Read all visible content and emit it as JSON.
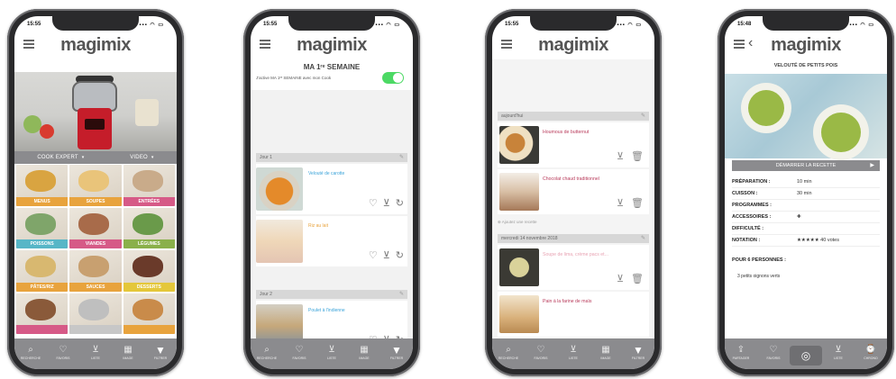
{
  "brand": {
    "logo": "magimix",
    "accent_pink": "#c2335b",
    "accent_blue": "#3aa3d9",
    "toggle_green": "#4cd964"
  },
  "phones": [
    {
      "time": "15:55",
      "tabs": [
        {
          "label": "COOK EXPERT",
          "chev": "▾"
        },
        {
          "label": "VIDEO",
          "chev": "▾"
        }
      ],
      "categories": [
        {
          "label": "MENUS",
          "color": "#e8a33d"
        },
        {
          "label": "SOUPES",
          "color": "#e8a33d"
        },
        {
          "label": "ENTRÉES",
          "color": "#d65a87"
        },
        {
          "label": "POISSONS",
          "color": "#57b6c7"
        },
        {
          "label": "VIANDES",
          "color": "#d65a87"
        },
        {
          "label": "LÉGUMES",
          "color": "#8ab04a"
        },
        {
          "label": "PÂTES/RIZ",
          "color": "#e8a33d"
        },
        {
          "label": "SAUCES",
          "color": "#e8a33d"
        },
        {
          "label": "DESSERTS",
          "color": "#e4c73a"
        },
        {
          "label": "",
          "color": "#d65a87"
        },
        {
          "label": "",
          "color": "#c7c7c7"
        },
        {
          "label": "",
          "color": "#e8a33d"
        }
      ]
    },
    {
      "time": "15:55",
      "title": "MA 1ʳᵉ SEMAINE",
      "toggle_label": "J'active MA 1ʳᵉ SEMAINE avec mon Cook",
      "days": [
        {
          "label": "Jour 1",
          "recipes": [
            {
              "name": "Velouté de carotte"
            },
            {
              "name": "Riz au lait"
            }
          ]
        },
        {
          "label": "Jour 2",
          "recipes": [
            {
              "name": "Poulet à l'indienne"
            }
          ]
        }
      ]
    },
    {
      "time": "15:55",
      "sections": [
        {
          "label": "aujourd'hui",
          "recipes": [
            {
              "name": "Houmous de butternut"
            },
            {
              "name": "Chocolat chaud traditionnel"
            }
          ]
        },
        {
          "label": "mercredi 14 novembre 2018",
          "recipes": [
            {
              "name": "Soupe de lima, crème pacs et..."
            },
            {
              "name": "Pain à la farine de maïs"
            }
          ]
        }
      ],
      "add_label": "Ajoutez une recette"
    },
    {
      "time": "15:48",
      "title": "VELOUTÉ DE PETITS POIS",
      "start_label": "DÉMARRER LA RECETTE",
      "info": [
        {
          "key": "PRÉPARATION :",
          "value": "10 min"
        },
        {
          "key": "CUISSON :",
          "value": "30 min"
        },
        {
          "key": "PROGRAMMES :",
          "value": ""
        },
        {
          "key": "ACCESSOIRES :",
          "value": "✚"
        },
        {
          "key": "DIFFICULTÉ :",
          "value": ""
        },
        {
          "key": "NOTATION :",
          "value": "★★★★★ 40 votes"
        }
      ],
      "persons_label": "POUR 6 PERSONNES :",
      "ingredient": "3 petits oignons verts"
    }
  ],
  "nav": [
    {
      "label": "RECHERCHE",
      "glyph": "⌕"
    },
    {
      "label": "FAVORIS",
      "glyph": "♡"
    },
    {
      "label": "LISTE",
      "glyph": "⊻"
    },
    {
      "label": "IMAGE",
      "glyph": "▦"
    },
    {
      "label": "FILTRER",
      "glyph": "▼"
    }
  ],
  "nav4": [
    {
      "label": "PARTAGER",
      "glyph": "⇪"
    },
    {
      "label": "FAVORIS",
      "glyph": "♡"
    },
    {
      "label": "",
      "glyph": ""
    },
    {
      "label": "LISTE",
      "glyph": "⊻"
    },
    {
      "label": "CHRONO",
      "glyph": "⌚"
    }
  ],
  "ui": {
    "status_icons": "▪▪▪ ◠ ▭"
  }
}
